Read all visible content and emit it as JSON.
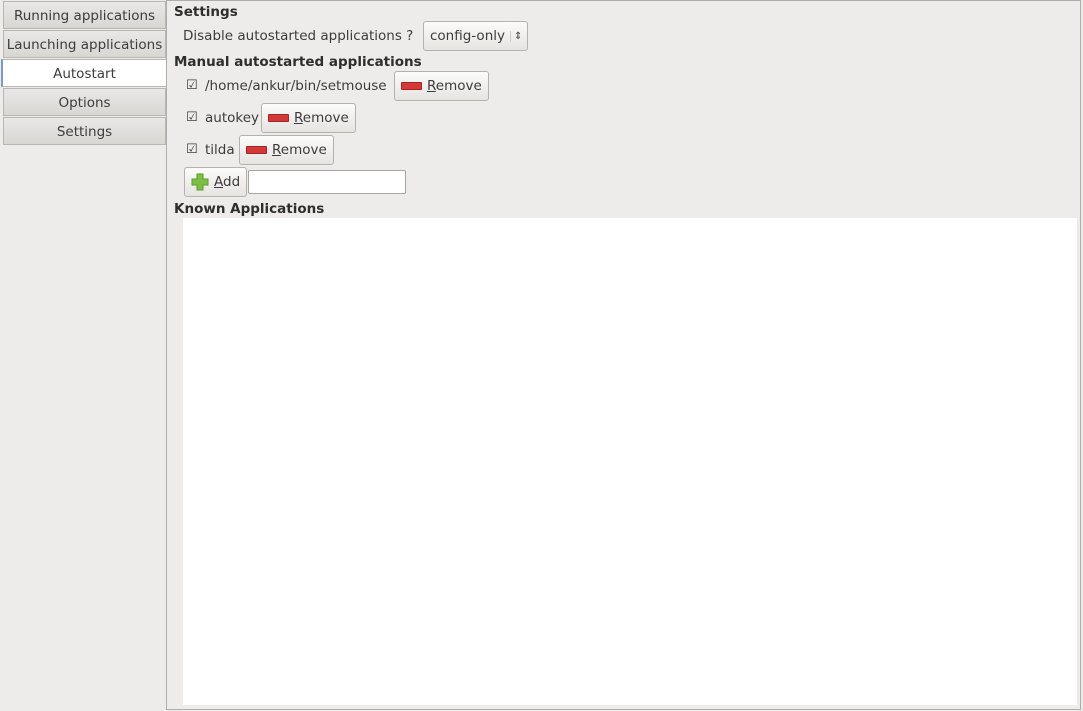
{
  "tabs": [
    {
      "label": "Running applications"
    },
    {
      "label": "Launching applications"
    },
    {
      "label": "Autostart",
      "selected": true
    },
    {
      "label": "Options"
    },
    {
      "label": "Settings"
    }
  ],
  "settings": {
    "heading": "Settings",
    "disable_label": "Disable autostarted applications ?",
    "disable_value": "config-only"
  },
  "manual": {
    "heading": "Manual autostarted applications",
    "items": [
      {
        "name": "/home/ankur/bin/setmouse",
        "checked": true
      },
      {
        "name": "autokey",
        "checked": true
      },
      {
        "name": "tilda",
        "checked": true
      }
    ],
    "remove_label": "Remove",
    "add_label": "Add",
    "add_value": ""
  },
  "known": {
    "heading": "Known Applications"
  },
  "colors": {
    "remove_icon": "#d23a3a",
    "add_icon": "#7cc043",
    "selected_tab_accent": "#7a9cc8"
  }
}
